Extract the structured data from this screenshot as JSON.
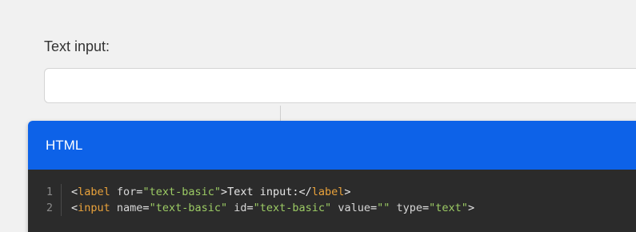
{
  "form": {
    "label": "Text input:",
    "input_value": "",
    "input_placeholder": ""
  },
  "panel": {
    "title": "HTML",
    "header_color": "#0d62e8",
    "code_lines": [
      {
        "num": "1",
        "tokens": [
          {
            "t": "<",
            "c": "punct"
          },
          {
            "t": "label",
            "c": "tag"
          },
          {
            "t": " for",
            "c": "attr"
          },
          {
            "t": "=",
            "c": "punct"
          },
          {
            "t": "\"text-basic\"",
            "c": "str"
          },
          {
            "t": ">Text input:</",
            "c": "txt"
          },
          {
            "t": "label",
            "c": "tag"
          },
          {
            "t": ">",
            "c": "punct"
          }
        ]
      },
      {
        "num": "2",
        "tokens": [
          {
            "t": "<",
            "c": "punct"
          },
          {
            "t": "input",
            "c": "tag"
          },
          {
            "t": " name",
            "c": "attr"
          },
          {
            "t": "=",
            "c": "punct"
          },
          {
            "t": "\"text-basic\"",
            "c": "str"
          },
          {
            "t": " id",
            "c": "attr"
          },
          {
            "t": "=",
            "c": "punct"
          },
          {
            "t": "\"text-basic\"",
            "c": "str"
          },
          {
            "t": " value",
            "c": "attr"
          },
          {
            "t": "=",
            "c": "punct"
          },
          {
            "t": "\"\"",
            "c": "str"
          },
          {
            "t": " type",
            "c": "attr"
          },
          {
            "t": "=",
            "c": "punct"
          },
          {
            "t": "\"text\"",
            "c": "str"
          },
          {
            "t": ">",
            "c": "punct"
          }
        ]
      }
    ]
  }
}
